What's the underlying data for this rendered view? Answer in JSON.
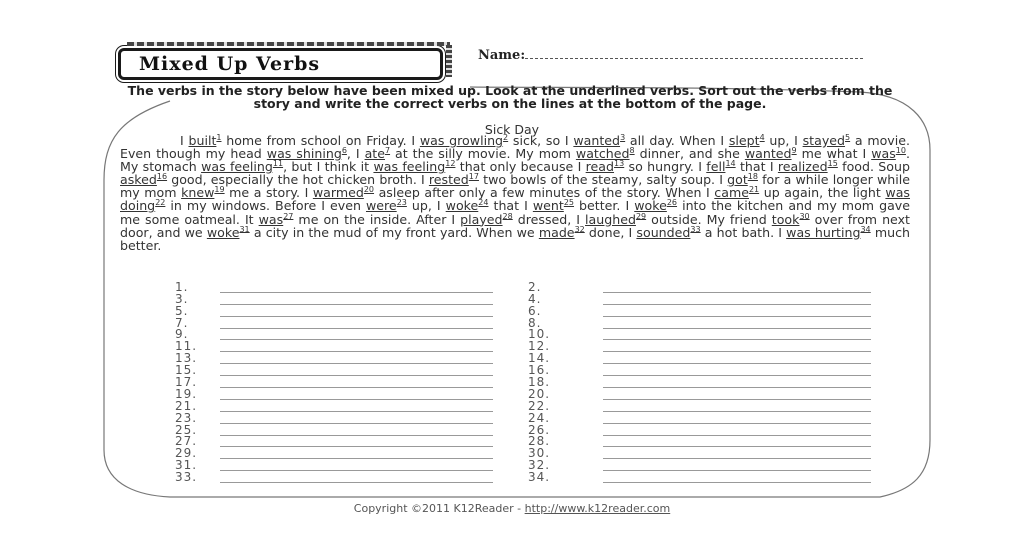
{
  "worksheet": {
    "title": "Mixed Up Verbs",
    "name_label": "Name:",
    "instructions": "The verbs in the story below have been mixed up. Look at the underlined verbs. Sort out the verbs from the story and write the correct verbs on the lines at the bottom of the page.",
    "story_title": "Sick Day",
    "story": [
      {
        "t": "I "
      },
      {
        "v": "built",
        "n": "1"
      },
      {
        "t": " home from school on Friday. I "
      },
      {
        "v": "was growling",
        "n": "2"
      },
      {
        "t": " sick, so I "
      },
      {
        "v": "wanted",
        "n": "3"
      },
      {
        "t": " all day. When I "
      },
      {
        "v": "slept",
        "n": "4"
      },
      {
        "t": " up, I "
      },
      {
        "v": "stayed",
        "n": "5"
      },
      {
        "t": " a movie. Even though my head "
      },
      {
        "v": "was shining",
        "n": "6"
      },
      {
        "t": ", I "
      },
      {
        "v": "ate",
        "n": "7"
      },
      {
        "t": " at the silly movie. My mom "
      },
      {
        "v": "watched",
        "n": "8"
      },
      {
        "t": " dinner, and she "
      },
      {
        "v": "wanted",
        "n": "9"
      },
      {
        "t": " me what I "
      },
      {
        "v": "was",
        "n": "10"
      },
      {
        "t": ". My stomach "
      },
      {
        "v": "was feeling",
        "n": "11"
      },
      {
        "t": ", but I think it "
      },
      {
        "v": "was feeling",
        "n": "12"
      },
      {
        "t": " that only because I "
      },
      {
        "v": "read",
        "n": "13"
      },
      {
        "t": " so hungry. I "
      },
      {
        "v": "fell",
        "n": "14"
      },
      {
        "t": " that I "
      },
      {
        "v": "realized",
        "n": "15"
      },
      {
        "t": " food. Soup "
      },
      {
        "v": "asked",
        "n": "16"
      },
      {
        "t": " good, especially the hot chicken broth. I "
      },
      {
        "v": "rested",
        "n": "17"
      },
      {
        "t": " two bowls of the steamy, salty soup. I "
      },
      {
        "v": "got",
        "n": "18"
      },
      {
        "t": " for a while longer while my mom "
      },
      {
        "v": "knew",
        "n": "19"
      },
      {
        "t": " me a story. I "
      },
      {
        "v": "warmed",
        "n": "20"
      },
      {
        "t": " asleep after only a few minutes of the story. When I "
      },
      {
        "v": "came",
        "n": "21"
      },
      {
        "t": " up again, the light "
      },
      {
        "v": "was doing",
        "n": "22"
      },
      {
        "t": " in my windows. Before I even "
      },
      {
        "v": "were",
        "n": "23"
      },
      {
        "t": " up, I "
      },
      {
        "v": "woke",
        "n": "24"
      },
      {
        "t": " that I "
      },
      {
        "v": "went",
        "n": "25"
      },
      {
        "t": " better. I "
      },
      {
        "v": "woke",
        "n": "26"
      },
      {
        "t": " into the kitchen and my mom gave me some oatmeal. It "
      },
      {
        "v": "was",
        "n": "27"
      },
      {
        "t": " me on the inside. After I "
      },
      {
        "v": "played",
        "n": "28"
      },
      {
        "t": " dressed, I "
      },
      {
        "v": "laughed",
        "n": "29"
      },
      {
        "t": " outside. My friend "
      },
      {
        "v": "took",
        "n": "30"
      },
      {
        "t": " over from next door, and we "
      },
      {
        "v": "woke",
        "n": "31"
      },
      {
        "t": " a city in the mud of my front yard. When we "
      },
      {
        "v": "made",
        "n": "32"
      },
      {
        "t": " done, I "
      },
      {
        "v": "sounded",
        "n": "33"
      },
      {
        "t": " a hot bath. I "
      },
      {
        "v": "was hurting",
        "n": "34"
      },
      {
        "t": " much better."
      }
    ],
    "answers_left": [
      "1.",
      "3.",
      "5.",
      "7.",
      "9.",
      "11.",
      "13.",
      "15.",
      "17.",
      "19.",
      "21.",
      "23.",
      "25.",
      "27.",
      "29.",
      "31.",
      "33."
    ],
    "answers_right": [
      "2.",
      "4.",
      "6.",
      "8.",
      "10.",
      "12.",
      "14.",
      "16.",
      "18.",
      "20.",
      "22.",
      "24.",
      "26.",
      "28.",
      "30.",
      "32.",
      "34."
    ],
    "copyright_text": "Copyright ©2011 K12Reader - ",
    "copyright_link": "http://www.k12reader.com"
  }
}
